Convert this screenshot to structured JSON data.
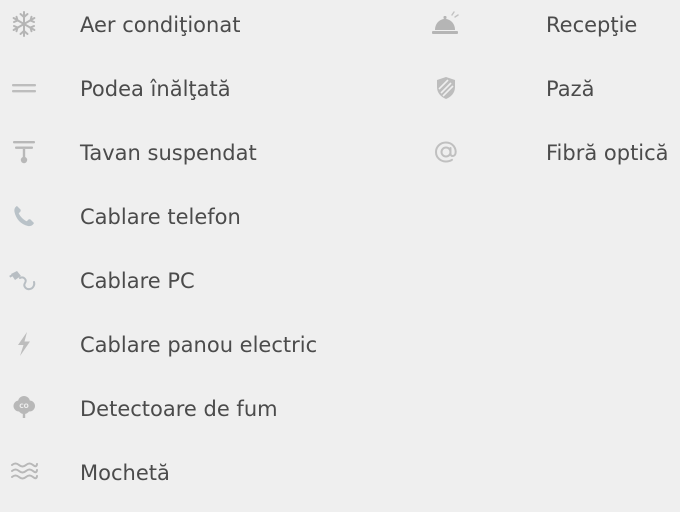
{
  "amenities": {
    "left": [
      {
        "icon": "snowflake-icon",
        "label": "Aer condiţionat"
      },
      {
        "icon": "raised-floor-icon",
        "label": "Podea înălţată"
      },
      {
        "icon": "suspended-ceiling-icon",
        "label": "Tavan suspendat"
      },
      {
        "icon": "phone-icon",
        "label": "Cablare telefon"
      },
      {
        "icon": "network-cable-icon",
        "label": "Cablare PC"
      },
      {
        "icon": "lightning-icon",
        "label": "Cablare panou electric"
      },
      {
        "icon": "smoke-detector-icon",
        "label": "Detectoare de fum"
      },
      {
        "icon": "carpet-icon",
        "label": "Mochetă"
      }
    ],
    "right": [
      {
        "icon": "reception-bell-icon",
        "label": "Recepţie"
      },
      {
        "icon": "security-shield-icon",
        "label": "Pază"
      },
      {
        "icon": "at-sign-icon",
        "label": "Fibră optică"
      }
    ]
  },
  "colors": {
    "background": "#efefef",
    "text": "#4b4b4b",
    "icon": "#b3b3b3"
  }
}
